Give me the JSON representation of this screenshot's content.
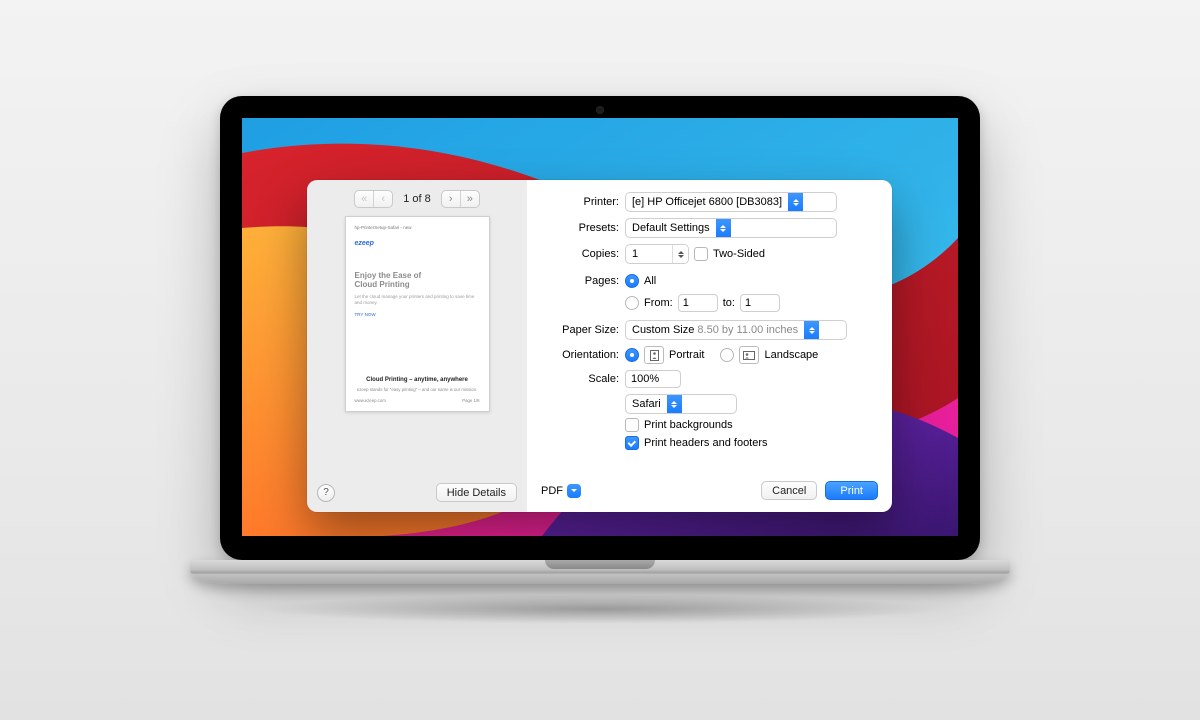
{
  "preview": {
    "page_indicator": "1 of 8",
    "page": {
      "url_bar": "hp-PrinterSetup-Safari - new",
      "logo": "ezeep",
      "heading": "Enjoy the Ease of\nCloud Printing",
      "sub": "Let the cloud manage your printers and printing to save time and money.",
      "cta": "TRY NOW",
      "banner": "Cloud Printing – anytime, anywhere",
      "tagline": "ezeep stands for \"easy printing\" – and our name is our mission.",
      "footer_left": "www.ezeep.com",
      "footer_right": "Page 1/8"
    },
    "hide_details": "Hide Details"
  },
  "labels": {
    "printer": "Printer:",
    "presets": "Presets:",
    "copies": "Copies:",
    "two_sided": "Two-Sided",
    "pages": "Pages:",
    "all": "All",
    "from": "From:",
    "to": "to:",
    "paper_size": "Paper Size:",
    "orientation": "Orientation:",
    "portrait": "Portrait",
    "landscape": "Landscape",
    "scale": "Scale:",
    "print_backgrounds": "Print backgrounds",
    "print_headers": "Print headers and footers"
  },
  "values": {
    "printer": "[e] HP Officejet 6800 [DB3083]",
    "presets": "Default Settings",
    "copies": "1",
    "two_sided_checked": false,
    "pages_mode": "all",
    "from": "1",
    "to": "1",
    "paper_size": "Custom Size",
    "paper_dims": "8.50 by 11.00 inches",
    "orientation": "portrait",
    "scale": "100%",
    "app": "Safari",
    "print_backgrounds": false,
    "print_headers": true
  },
  "footer": {
    "pdf": "PDF",
    "cancel": "Cancel",
    "print": "Print"
  }
}
